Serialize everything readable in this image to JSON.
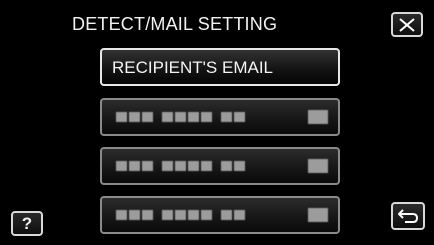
{
  "screen": {
    "title": "DETECT/MAIL SETTING"
  },
  "buttons": {
    "close_icon": "close-icon",
    "help_label": "?",
    "back_icon": "return-icon"
  },
  "menu": {
    "items": [
      {
        "label": "RECIPIENT'S EMAIL",
        "state": "selected"
      },
      {
        "label": "",
        "state": "disabled"
      },
      {
        "label": "",
        "state": "disabled"
      },
      {
        "label": "",
        "state": "disabled"
      }
    ]
  },
  "colors": {
    "background": "#000000",
    "button_border": "#d8d8d8",
    "placeholder": "#9c9c9c"
  }
}
